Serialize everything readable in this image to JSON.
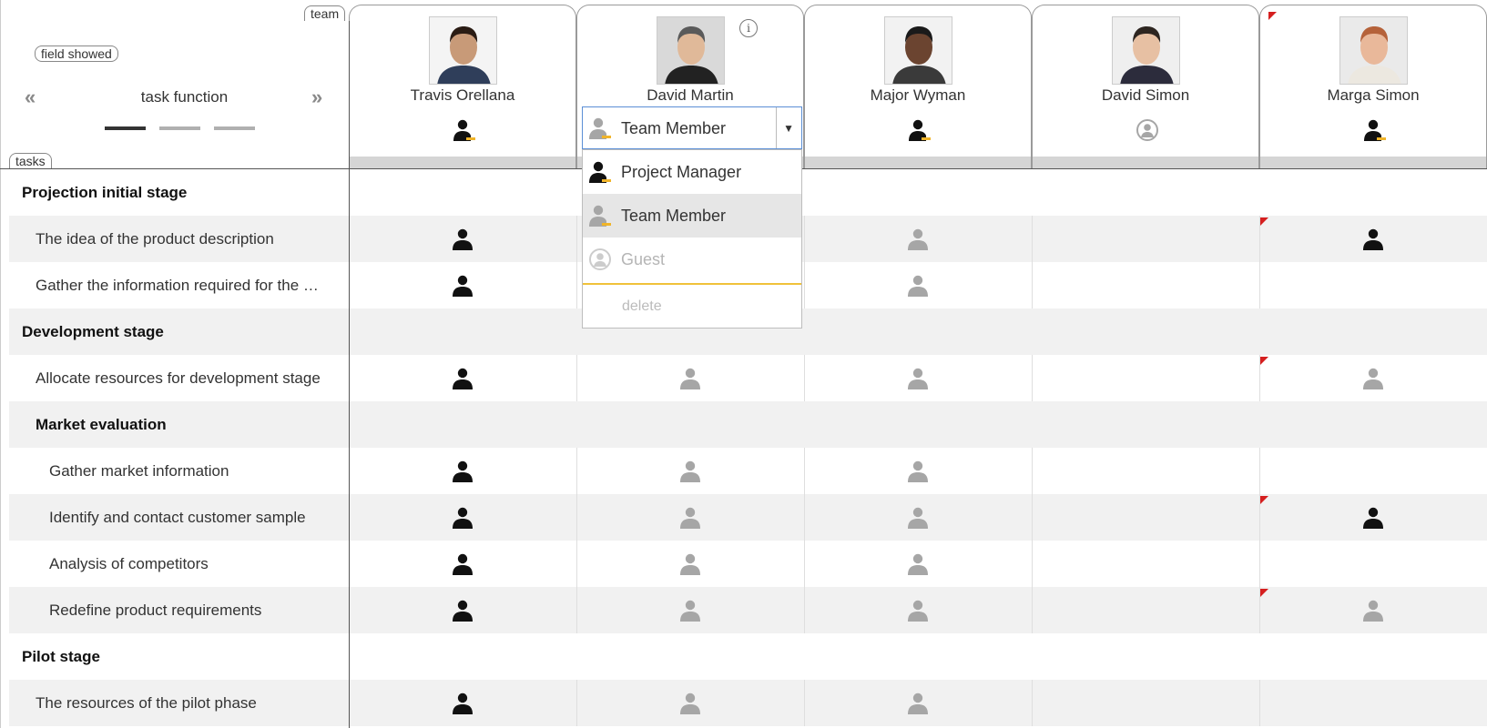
{
  "controls": {
    "field_showed": "field showed",
    "team_tab": "team",
    "tasks_tab": "tasks",
    "task_function": "task function",
    "arrow_left": "«",
    "arrow_right": "»"
  },
  "team": [
    {
      "name": "Travis Orellana",
      "role_icon": "project-manager-icon"
    },
    {
      "name": "David Martin",
      "role_icon": "team-member-icon",
      "info": "i"
    },
    {
      "name": "Major Wyman",
      "role_icon": "project-manager-icon"
    },
    {
      "name": "David Simon",
      "role_icon": "guest-icon"
    },
    {
      "name": "Marga Simon",
      "role_icon": "project-manager-icon"
    }
  ],
  "role_dropdown": {
    "selected": "Team Member",
    "options": [
      "Project Manager",
      "Team Member",
      "Guest"
    ],
    "delete_label": "delete"
  },
  "tasks": [
    {
      "label": "Projection initial stage",
      "type": "header"
    },
    {
      "label": "The idea of the product description",
      "type": "task"
    },
    {
      "label": "Gather the information required for the …",
      "type": "task"
    },
    {
      "label": "Development stage",
      "type": "header"
    },
    {
      "label": "Allocate resources for development stage",
      "type": "task"
    },
    {
      "label": "Market evaluation",
      "type": "subheader"
    },
    {
      "label": "Gather market information",
      "type": "subtask"
    },
    {
      "label": "Identify and contact customer sample",
      "type": "subtask"
    },
    {
      "label": "Analysis of competitors",
      "type": "subtask"
    },
    {
      "label": "Redefine product requirements",
      "type": "subtask"
    },
    {
      "label": "Pilot stage",
      "type": "header"
    },
    {
      "label": "The resources of the pilot phase",
      "type": "task"
    }
  ],
  "colors": {
    "assigned_dark": "#111111",
    "assigned_grey": "#a6a6a6",
    "row_shade": "#f1f1f1",
    "flag_red": "#d51f1f",
    "menu_separator": "#f0c23a",
    "select_border": "#5b8fd6"
  }
}
